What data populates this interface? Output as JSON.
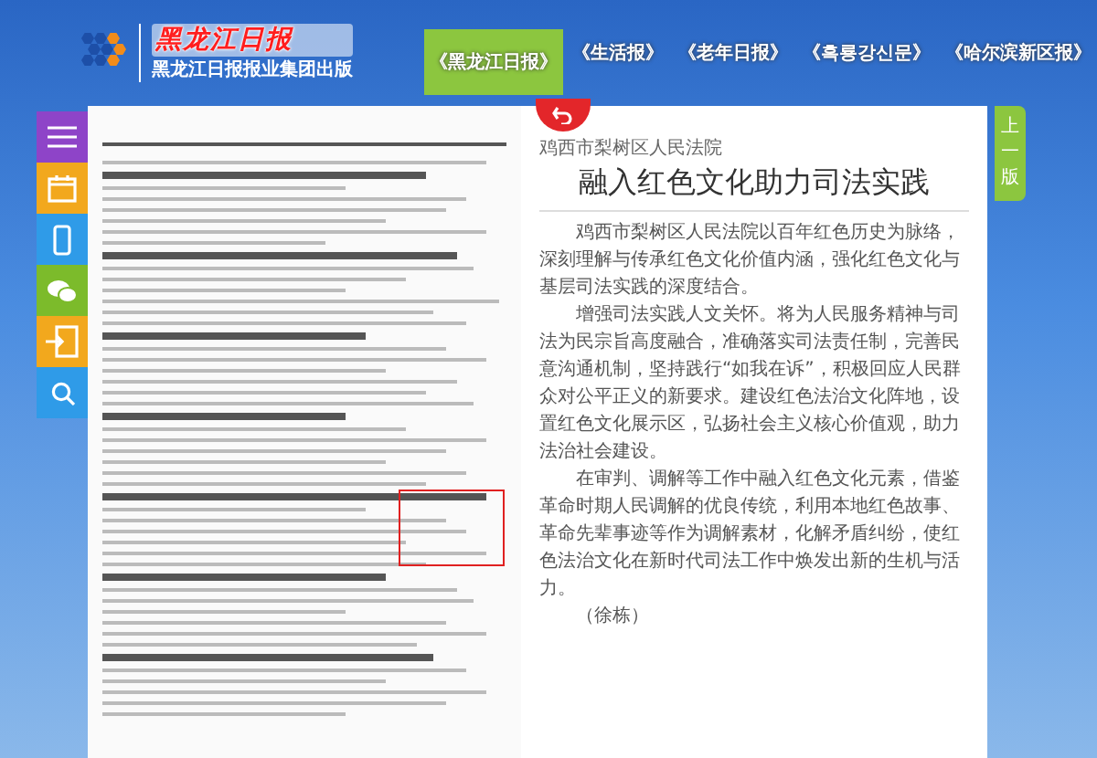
{
  "header": {
    "logo_title": "黑龙江日报",
    "logo_subtitle": "黑龙江日报报业集团出版"
  },
  "tabs": [
    {
      "label": "《黑龙江日报》",
      "selected": true
    },
    {
      "label": "《生活报》",
      "selected": false
    },
    {
      "label": "《老年日报》",
      "selected": false
    },
    {
      "label": "《흑룡강신문》",
      "selected": false
    },
    {
      "label": "《哈尔滨新区报》",
      "selected": false
    }
  ],
  "sidebar": {
    "items": [
      {
        "kind": "menu",
        "color": "#8e44c8"
      },
      {
        "kind": "calendar",
        "color": "#f2a81d"
      },
      {
        "kind": "phone",
        "color": "#2f9be8"
      },
      {
        "kind": "wechat",
        "color": "#7cbb2b"
      },
      {
        "kind": "issues",
        "color": "#f2a81d"
      },
      {
        "kind": "search",
        "color": "#2f9be8"
      }
    ]
  },
  "article": {
    "source": "鸡西市梨树区人民法院",
    "title": "融入红色文化助力司法实践",
    "paragraphs": [
      "鸡西市梨树区人民法院以百年红色历史为脉络，深刻理解与传承红色文化价值内涵，强化红色文化与基层司法实践的深度结合。",
      "增强司法实践人文关怀。将为人民服务精神与司法为民宗旨高度融合，准确落实司法责任制，完善民意沟通机制，坚持践行“如我在诉”，积极回应人民群众对公平正义的新要求。建设红色法治文化阵地，设置红色文化展示区，弘扬社会主义核心价值观，助力法治社会建设。",
      "在审判、调解等工作中融入红色文化元素，借鉴革命时期人民调解的优良传统，利用本地红色故事、革命先辈事迹等作为调解素材，化解矛盾纠纷，使红色法治文化在新时代司法工作中焕发出新的生机与活力。"
    ],
    "author": "（徐栋）"
  },
  "page_nav": {
    "previous": "上一版"
  }
}
